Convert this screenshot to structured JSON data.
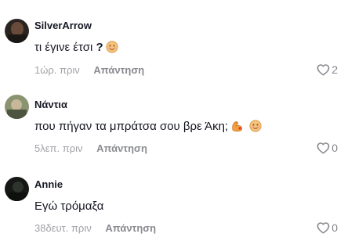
{
  "comments": [
    {
      "username": "SilverArrow",
      "text": "τι έγινε έτσι",
      "text_suffix": "?",
      "time": "1ώρ. πριν",
      "reply_label": "Απάντηση",
      "likes": "2",
      "avatar_color": "#3a2f2a"
    },
    {
      "username": "Νάντια",
      "text": "που πήγαν τα μπράτσα σου βρε Άκη;",
      "text_suffix": "",
      "time": "5λεπ. πριν",
      "reply_label": "Απάντηση",
      "likes": "0",
      "avatar_color": "#6f7a55"
    },
    {
      "username": "Annie",
      "text": "Εγώ τρόμαξα",
      "text_suffix": "",
      "time": "38δευτ. πριν",
      "reply_label": "Απάντηση",
      "likes": "0",
      "avatar_color": "#1a1d1a"
    }
  ],
  "icons": {
    "like": "heart-outline-icon",
    "emoji_face": "smiling-face-icon",
    "emoji_muscle": "muscle-icon"
  }
}
